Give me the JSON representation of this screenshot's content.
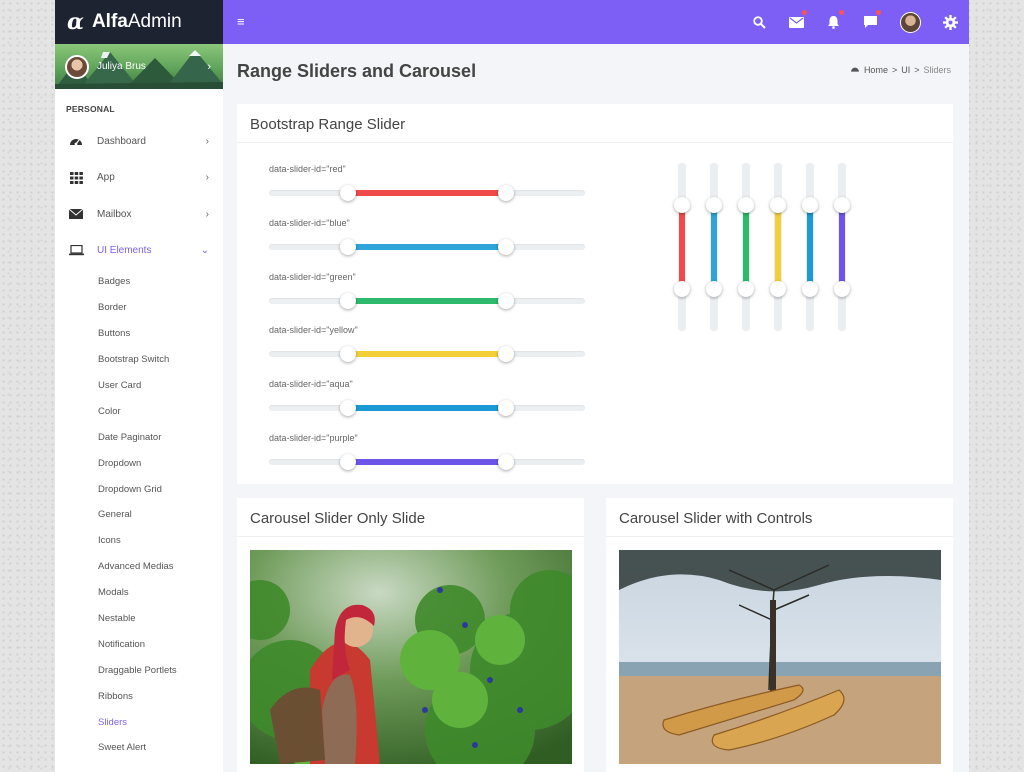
{
  "brand": {
    "prefix": "Alfa",
    "suffix": "Admin",
    "symbol": "α"
  },
  "user": {
    "name": "Juliya Brus"
  },
  "sidebar": {
    "section": "PERSONAL",
    "items": [
      {
        "label": "Dashboard",
        "icon": "dashboard-icon"
      },
      {
        "label": "App",
        "icon": "grid-icon"
      },
      {
        "label": "Mailbox",
        "icon": "envelope-icon"
      },
      {
        "label": "UI Elements",
        "icon": "laptop-icon"
      }
    ],
    "sub_items": [
      "Badges",
      "Border",
      "Buttons",
      "Bootstrap Switch",
      "User Card",
      "Color",
      "Date Paginator",
      "Dropdown",
      "Dropdown Grid",
      "General",
      "Icons",
      "Advanced Medias",
      "Modals",
      "Nestable",
      "Notification",
      "Draggable Portlets",
      "Ribbons",
      "Sliders",
      "Sweet Alert"
    ],
    "active_sub": "Sliders"
  },
  "topbar": {
    "menu_glyph": "≡"
  },
  "page": {
    "title": "Range Sliders and Carousel"
  },
  "breadcrumb": {
    "home": "Home",
    "sep": ">",
    "section": "UI",
    "current": "Sliders"
  },
  "range_card": {
    "title": "Bootstrap Range Slider",
    "range_min": 0.25,
    "range_max": 0.75,
    "sliders": [
      {
        "label": "data-slider-id=\"red\"",
        "color": "#ef4b4b"
      },
      {
        "label": "data-slider-id=\"blue\"",
        "color": "#2ea4d9"
      },
      {
        "label": "data-slider-id=\"green\"",
        "color": "#2dba6c"
      },
      {
        "label": "data-slider-id=\"yellow\"",
        "color": "#f3d03a"
      },
      {
        "label": "data-slider-id=\"aqua\"",
        "color": "#1b9ad6"
      },
      {
        "label": "data-slider-id=\"purple\"",
        "color": "#6e55e9"
      }
    ],
    "vertical_colors": [
      "#ef4b4b",
      "#2ea4d9",
      "#2dba6c",
      "#f3d03a",
      "#1b9ad6",
      "#6e55e9"
    ]
  },
  "carousel_a": {
    "title": "Carousel Slider Only Slide"
  },
  "carousel_b": {
    "title": "Carousel Slider with Controls"
  },
  "colors": {
    "accent": "#7d5ff5",
    "sidebar_dark": "#1d2330"
  }
}
